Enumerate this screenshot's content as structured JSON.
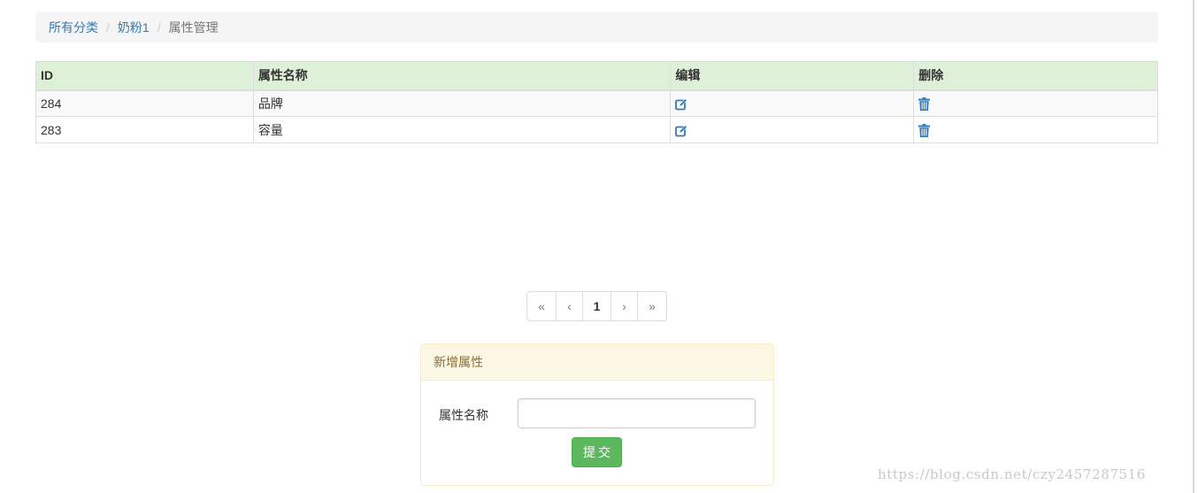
{
  "breadcrumb": {
    "items": [
      {
        "label": "所有分类"
      },
      {
        "label": "奶粉1"
      }
    ],
    "separator": "/",
    "active": "属性管理"
  },
  "table": {
    "headers": [
      "ID",
      "属性名称",
      "编辑",
      "删除"
    ],
    "header_bg": "#dff0d8",
    "rows": [
      {
        "id": "284",
        "name": "品牌",
        "edit_icon": "edit-icon",
        "delete_icon": "trash-icon"
      },
      {
        "id": "283",
        "name": "容量",
        "edit_icon": "edit-icon",
        "delete_icon": "trash-icon"
      }
    ]
  },
  "pagination": {
    "first": "«",
    "prev": "‹",
    "current": "1",
    "next": "›",
    "last": "»"
  },
  "add_panel": {
    "title": "新增属性",
    "field_label": "属性名称",
    "field_value": "",
    "submit_label": "提交"
  },
  "watermark": "https://blog.csdn.net/czy2457287516",
  "colors": {
    "link": "#337ab7",
    "panel_heading_bg": "#fcf8e3",
    "panel_border": "#faebcc",
    "submit_bg": "#5cb85c"
  }
}
